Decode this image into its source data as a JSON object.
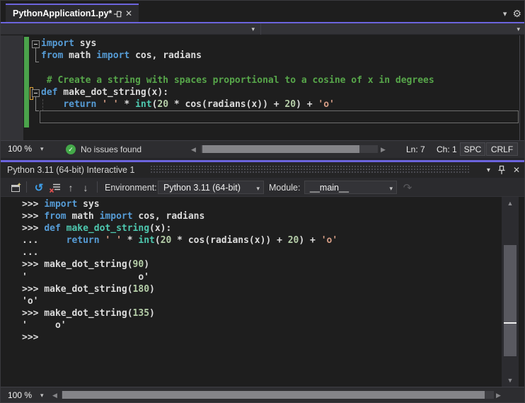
{
  "tab": {
    "title": "PythonApplication1.py*"
  },
  "editor_status": {
    "zoom": "100 %",
    "issues": "No issues found",
    "line": "Ln: 7",
    "column": "Ch: 1",
    "spaces": "SPC",
    "line_endings": "CRLF"
  },
  "repl": {
    "title": "Python 3.11 (64-bit) Interactive 1",
    "toolbar": {
      "environment_label": "Environment:",
      "environment_value": "Python 3.11 (64-bit)",
      "module_label": "Module:",
      "module_value": "__main__"
    },
    "status": {
      "zoom": "100 %"
    }
  },
  "icons": {
    "close": "✕",
    "gear": "⚙",
    "chevron_down": "▾",
    "check": "✓",
    "arrow_up": "↑",
    "arrow_down": "↓",
    "reset": "↺",
    "redo": "↷",
    "scroll_up": "▲",
    "scroll_down": "▼",
    "scroll_left": "◀",
    "scroll_right": "▶"
  },
  "colors": {
    "accent": "#6c64dd",
    "editor_bg": "#1e1e1e",
    "chrome_bg": "#2d2d30",
    "keyword": "#569cd6",
    "string": "#d69d85",
    "number": "#b5cea8",
    "comment": "#57a64a",
    "function": "#4ec9b0",
    "text": "#dcdcdc",
    "change_bar_saved": "#4ba34b",
    "change_bar_unsaved": "#d9a036",
    "issues_check": "#44a949"
  },
  "code": {
    "editor_lines": [
      [
        [
          "kw",
          "import"
        ],
        [
          "pl",
          " sys"
        ]
      ],
      [
        [
          "kw",
          "from"
        ],
        [
          "pl",
          " math "
        ],
        [
          "kw",
          "import"
        ],
        [
          "pl",
          " cos, radians"
        ]
      ],
      [],
      [
        [
          "cm",
          " # Create a string with spaces proportional to a cosine of x in degrees"
        ]
      ],
      [
        [
          "kw",
          "def"
        ],
        [
          "pl",
          " make_dot_string(x):"
        ]
      ],
      [
        [
          "pl",
          "    "
        ],
        [
          "kw",
          "return"
        ],
        [
          "pl",
          " "
        ],
        [
          "st",
          "' '"
        ],
        [
          "pl",
          " * "
        ],
        [
          "fn",
          "int"
        ],
        [
          "pl",
          "("
        ],
        [
          "nm",
          "20"
        ],
        [
          "pl",
          " * cos(radians(x)) + "
        ],
        [
          "nm",
          "20"
        ],
        [
          "pl",
          ") + "
        ],
        [
          "st",
          "'o'"
        ]
      ],
      []
    ],
    "repl_lines": [
      [
        [
          "pl",
          ">>> "
        ],
        [
          "kw",
          "import"
        ],
        [
          "pl",
          " sys"
        ]
      ],
      [
        [
          "pl",
          ">>> "
        ],
        [
          "kw",
          "from"
        ],
        [
          "pl",
          " math "
        ],
        [
          "kw",
          "import"
        ],
        [
          "pl",
          " cos, radians"
        ]
      ],
      [
        [
          "pl",
          ">>> "
        ],
        [
          "kw",
          "def"
        ],
        [
          "pl",
          " "
        ],
        [
          "fn",
          "make_dot_string"
        ],
        [
          "pl",
          "(x):"
        ]
      ],
      [
        [
          "pl",
          "...     "
        ],
        [
          "kw",
          "return"
        ],
        [
          "pl",
          " "
        ],
        [
          "st",
          "' '"
        ],
        [
          "pl",
          " * "
        ],
        [
          "fn",
          "int"
        ],
        [
          "pl",
          "("
        ],
        [
          "nm",
          "20"
        ],
        [
          "pl",
          " * cos(radians(x)) + "
        ],
        [
          "nm",
          "20"
        ],
        [
          "pl",
          ") + "
        ],
        [
          "st",
          "'o'"
        ]
      ],
      [
        [
          "pl",
          "..."
        ]
      ],
      [
        [
          "pl",
          ">>> make_dot_string("
        ],
        [
          "nm",
          "90"
        ],
        [
          "pl",
          ")"
        ]
      ],
      [
        [
          "pl",
          "'                    o'"
        ]
      ],
      [
        [
          "pl",
          ">>> make_dot_string("
        ],
        [
          "nm",
          "180"
        ],
        [
          "pl",
          ")"
        ]
      ],
      [
        [
          "pl",
          "'o'"
        ]
      ],
      [
        [
          "pl",
          ">>> make_dot_string("
        ],
        [
          "nm",
          "135"
        ],
        [
          "pl",
          ")"
        ]
      ],
      [
        [
          "pl",
          "'     o'"
        ]
      ],
      [
        [
          "pl",
          ">>>"
        ]
      ]
    ]
  }
}
